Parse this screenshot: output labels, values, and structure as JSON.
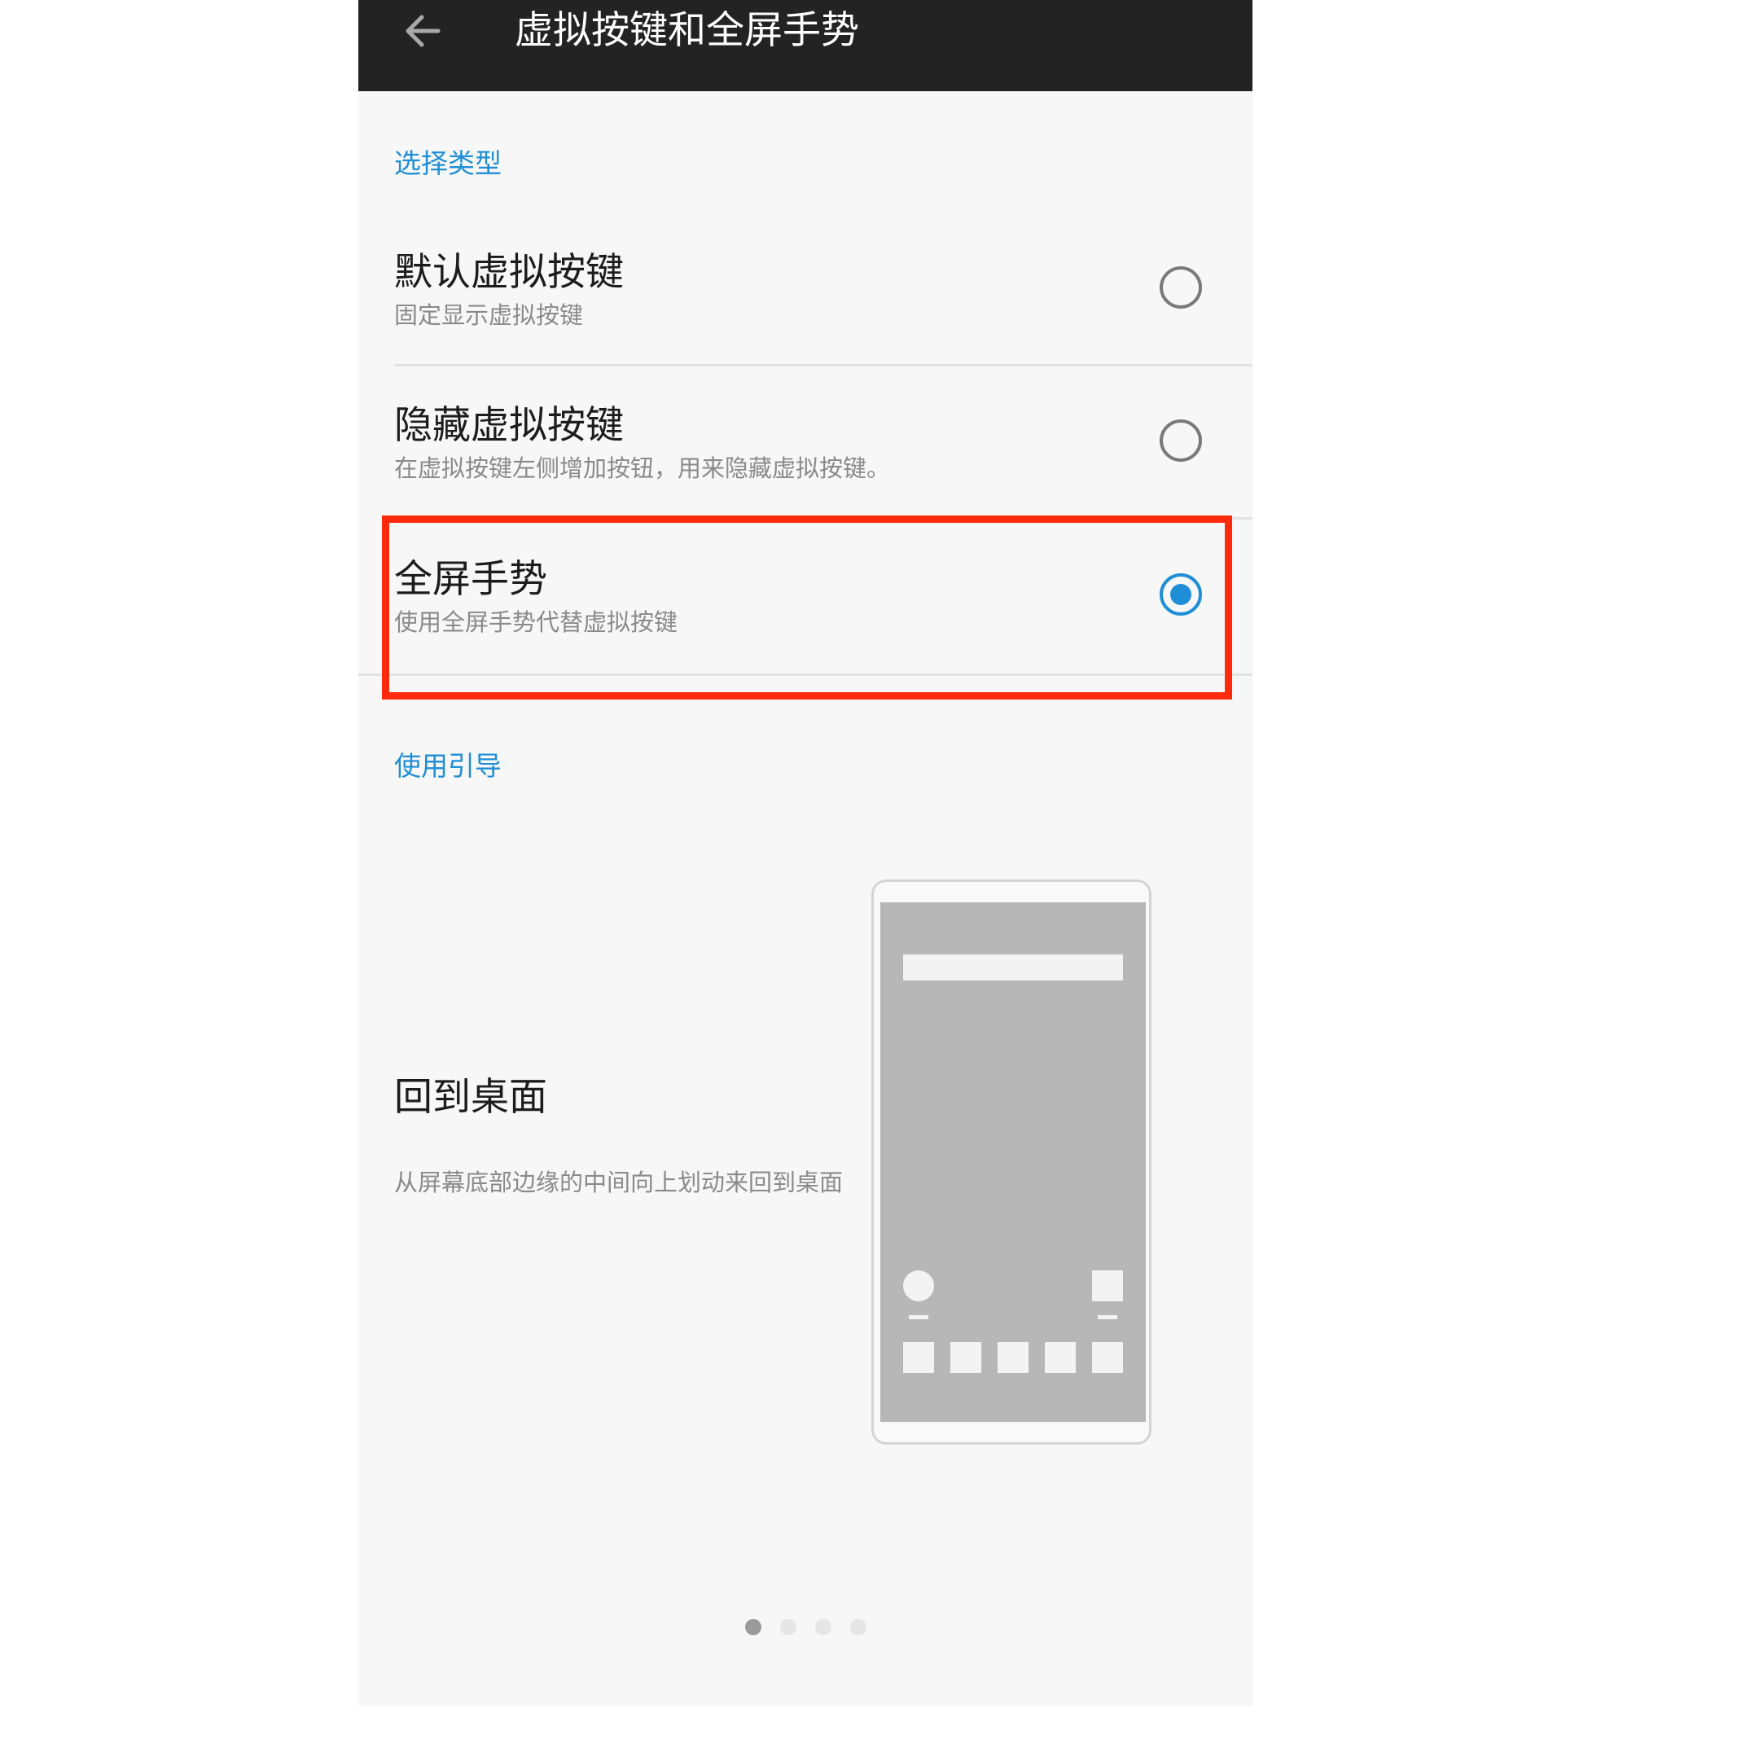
{
  "app_bar": {
    "back_icon": "arrow-left-icon",
    "title": "虚拟按键和全屏手势"
  },
  "section_type": {
    "header": "选择类型",
    "options": [
      {
        "title": "默认虚拟按键",
        "description": "固定显示虚拟按键",
        "selected": false
      },
      {
        "title": "隐藏虚拟按键",
        "description": "在虚拟按键左侧增加按钮，用来隐藏虚拟按键。",
        "selected": false
      },
      {
        "title": "全屏手势",
        "description": "使用全屏手势代替虚拟按键",
        "selected": true
      }
    ]
  },
  "section_guide": {
    "header": "使用引导",
    "title": "回到桌面",
    "description": "从屏幕底部边缘的中间向上划动来回到桌面",
    "current_page": 1,
    "total_pages": 4
  },
  "colors": {
    "accent": "#1e8ed6",
    "app_bar": "#232323",
    "highlight": "#ff2a0c",
    "background": "#f7f7f7"
  }
}
